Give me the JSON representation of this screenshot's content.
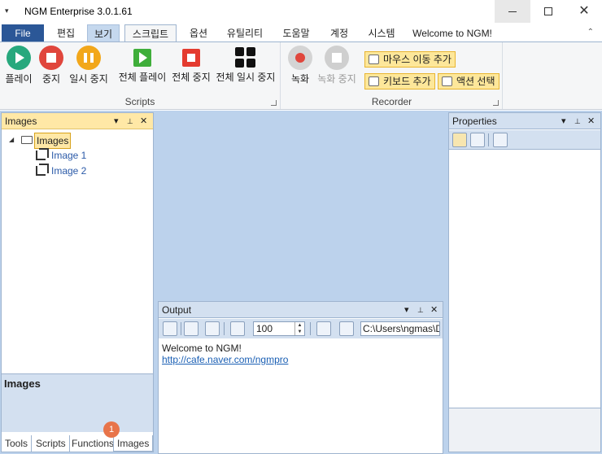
{
  "window": {
    "title": "NGM Enterprise 3.0.1.61",
    "quick_access": "▾",
    "minimize": "",
    "maximize": "",
    "close": "✕"
  },
  "tabs": [
    {
      "label": "File"
    },
    {
      "label": "편집"
    },
    {
      "label": "보기"
    },
    {
      "label": "스크립트"
    },
    {
      "label": "옵션"
    },
    {
      "label": "유틸리티"
    },
    {
      "label": "도움말"
    },
    {
      "label": "계정"
    },
    {
      "label": "시스템"
    },
    {
      "label": "Welcome to NGM!"
    }
  ],
  "ribbon": {
    "collapse": "⌃",
    "script_group": {
      "label": "Scripts",
      "buttons": [
        {
          "label": "플레이",
          "color": "#27a87d"
        },
        {
          "label": "중지",
          "color": "#e0463c"
        },
        {
          "label": "일시 중지",
          "color": "#f2a71b"
        },
        {
          "label": "전체 플레이",
          "color": "#3fae3a"
        },
        {
          "label": "전체 중지",
          "color": "#e43b2f"
        },
        {
          "label": "전체 일시 중지",
          "color": "#111111"
        }
      ]
    },
    "recorder_group": {
      "label": "Recorder",
      "record": {
        "label": "녹화",
        "color": "#e0463c"
      },
      "stop_record": {
        "label": "녹화 중지"
      },
      "add_mouse": {
        "label": "마우스 이동 추가"
      },
      "add_keyboard": {
        "label": "키보드 추가"
      },
      "select_action": {
        "label": "액션 선택"
      }
    }
  },
  "images_panel": {
    "title": "Images",
    "tree": {
      "root": "Images",
      "children": [
        "Image 1",
        "Image 2"
      ]
    },
    "description_title": "Images",
    "bottom_tabs": [
      "Tools",
      "Scripts",
      "Functions",
      "Images"
    ],
    "badge": "1"
  },
  "output_panel": {
    "title": "Output",
    "line_count": "100",
    "path": "C:\\Users\\ngmas\\D",
    "lines": [
      "Welcome to NGM!",
      "http://cafe.naver.com/ngmpro"
    ]
  },
  "properties_panel": {
    "title": "Properties"
  },
  "panel_controls": {
    "dropdown": "▾",
    "pin": "📌",
    "close": "✕"
  }
}
